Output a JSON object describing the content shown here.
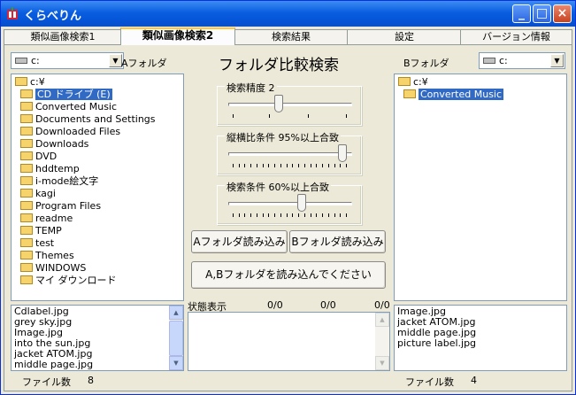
{
  "window": {
    "title": "くらべりん",
    "minimize": "_",
    "maximize": "□",
    "close": "×"
  },
  "tabs": [
    "類似画像検索1",
    "類似画像検索2",
    "検索結果",
    "設定",
    "バージョン情報"
  ],
  "main_title": "フォルダ比較検索",
  "left": {
    "drive": "c:",
    "folder_label": "Aフォルダ",
    "tree": [
      {
        "label": "c:¥"
      },
      {
        "label": "CD ドライブ (E)",
        "selected": true
      },
      {
        "label": "Converted Music"
      },
      {
        "label": "Documents and Settings"
      },
      {
        "label": "Downloaded Files"
      },
      {
        "label": "Downloads"
      },
      {
        "label": "DVD"
      },
      {
        "label": "hddtemp"
      },
      {
        "label": "i-mode絵文字"
      },
      {
        "label": "kagi"
      },
      {
        "label": "Program Files"
      },
      {
        "label": "readme"
      },
      {
        "label": "TEMP"
      },
      {
        "label": "test"
      },
      {
        "label": "Themes"
      },
      {
        "label": "WINDOWS"
      },
      {
        "label": "マイ ダウンロード"
      }
    ],
    "files": [
      "Cdlabel.jpg",
      "grey sky.jpg",
      "Image.jpg",
      "into the sun.jpg",
      "jacket ATOM.jpg",
      "middle page.jpg"
    ],
    "file_count_label": "ファイル数",
    "file_count": "8"
  },
  "right": {
    "drive": "c:",
    "folder_label": "Bフォルダ",
    "tree": [
      {
        "label": "c:¥"
      },
      {
        "label": "Converted Music",
        "selected": true
      }
    ],
    "files": [
      "Image.jpg",
      "jacket ATOM.jpg",
      "middle page.jpg",
      "picture label.jpg"
    ],
    "file_count_label": "ファイル数",
    "file_count": "4"
  },
  "sliders": {
    "accuracy": {
      "label": "検索精度  2",
      "value_fraction": 0.4
    },
    "aspect": {
      "label": "縦横比条件  95%以上合致",
      "value_fraction": 0.95
    },
    "condition": {
      "label": "検索条件  60%以上合致",
      "value_fraction": 0.6
    }
  },
  "buttons": {
    "load_a": "Aフォルダ読み込み",
    "load_b": "Bフォルダ読み込み",
    "load_both": "A,Bフォルダを読み込んでください"
  },
  "status": {
    "label": "状態表示",
    "values": [
      "0/0",
      "0/0",
      "0/0"
    ]
  },
  "colors": {
    "titlebar": "#0a5ee0",
    "selection": "#316ac5",
    "tab_highlight": "#ffc83c"
  }
}
